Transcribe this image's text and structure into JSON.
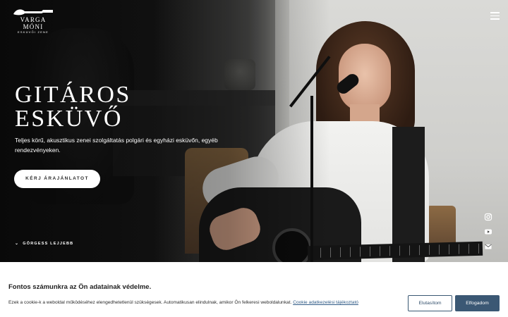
{
  "logo": {
    "name": "VARGA MÓNI",
    "subtitle": "ESKÜVŐI ZENE"
  },
  "hero": {
    "title_line1": "GITÁROS",
    "title_line2": "ESKÜVŐ",
    "description": "Teljes körű, akusztikus zenei szolgáltatás polgári és egyházi esküvőn, egyéb rendezvényeken.",
    "cta_label": "KÉRJ ÁRAJÁNLATOT",
    "scroll_label": "GÖRGESS LEJJEBB"
  },
  "social_icons": [
    "instagram-icon",
    "youtube-icon",
    "email-icon"
  ],
  "cookie": {
    "title": "Fontos számunkra az Ön adatainak védelme.",
    "text": "Ezek a cookie-k a weboldal működéséhez elengedhetetlenül szükségesek. Automatikusan elindulnak, amikor Ön felkeresi weboldalunkat.",
    "link_label": "Cookie adatkezelési tájékoztató",
    "reject_label": "Elutasítom",
    "accept_label": "Elfogadom"
  },
  "colors": {
    "accent": "#3b5874",
    "link": "#2f5a86"
  }
}
